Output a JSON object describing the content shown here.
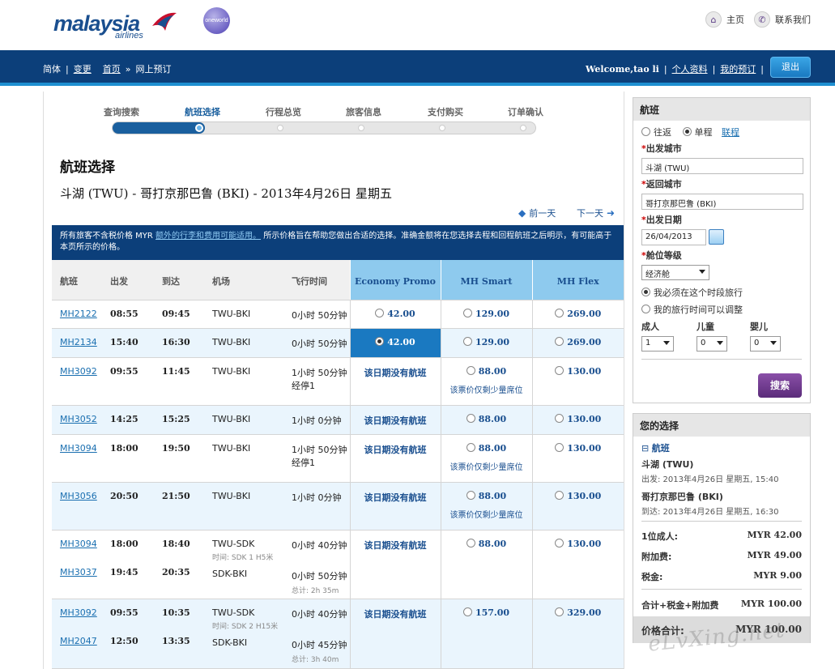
{
  "header": {
    "brand": "malaysia",
    "brand_sub": "airlines",
    "alliance": "oneworld",
    "home": "主页",
    "contact": "联系我们"
  },
  "nav": {
    "lang": "简体",
    "change": "变更",
    "home": "首页",
    "sep": "»",
    "current": "网上预订",
    "welcome": "Welcome,tao li",
    "profile": "个人资料",
    "bookings": "我的预订",
    "logout": "退出"
  },
  "steps": [
    "查询搜索",
    "航班选择",
    "行程总览",
    "旅客信息",
    "支付购买",
    "订单确认"
  ],
  "progress_step": 2,
  "page": {
    "heading": "航班选择",
    "route": "斗湖 (TWU) - 哥打京那巴鲁 (BKI) - 2013年4月26日 星期五",
    "prev_day": "前一天",
    "next_day": "下一天"
  },
  "notice": {
    "part1": "所有旅客不含税价格 MYR ",
    "link": "额外的行李和费用可能适用。",
    "part2": " 所示价格旨在帮助您做出合适的选择。准确金额将在您选择去程和回程航班之后明示，有可能高于本页所示的价格。"
  },
  "table": {
    "headers": [
      "航班",
      "出发",
      "到达",
      "机场",
      "飞行时间"
    ],
    "fares": [
      "Economy Promo",
      "MH Smart",
      "MH Flex"
    ],
    "no_flight": "该日期没有航班",
    "seat_note": "该票价仅剩少量席位",
    "rows": [
      {
        "legs": [
          {
            "flight": "MH2122",
            "dep": "08:55",
            "arr": "09:45",
            "airport": "TWU-BKI",
            "duration": "0小时  50分钟"
          }
        ],
        "promo": "42.00",
        "smart": "129.00",
        "flex": "269.00"
      },
      {
        "legs": [
          {
            "flight": "MH2134",
            "dep": "15:40",
            "arr": "16:30",
            "airport": "TWU-BKI",
            "duration": "0小时  50分钟"
          }
        ],
        "promo": "42.00",
        "smart": "129.00",
        "flex": "269.00",
        "selected": true
      },
      {
        "legs": [
          {
            "flight": "MH3092",
            "dep": "09:55",
            "arr": "11:45",
            "airport": "TWU-BKI",
            "duration": "1小时  50分钟",
            "stop": "经停1"
          }
        ],
        "smart": "88.00",
        "flex": "130.00",
        "seat_note": true
      },
      {
        "legs": [
          {
            "flight": "MH3052",
            "dep": "14:25",
            "arr": "15:25",
            "airport": "TWU-BKI",
            "duration": "1小时  0分钟"
          }
        ],
        "smart": "88.00",
        "flex": "130.00"
      },
      {
        "legs": [
          {
            "flight": "MH3094",
            "dep": "18:00",
            "arr": "19:50",
            "airport": "TWU-BKI",
            "duration": "1小时  50分钟",
            "stop": "经停1"
          }
        ],
        "smart": "88.00",
        "flex": "130.00",
        "seat_note": true
      },
      {
        "legs": [
          {
            "flight": "MH3056",
            "dep": "20:50",
            "arr": "21:50",
            "airport": "TWU-BKI",
            "duration": "1小时  0分钟"
          }
        ],
        "smart": "88.00",
        "flex": "130.00",
        "seat_note": true
      },
      {
        "legs": [
          {
            "flight": "MH3094",
            "dep": "18:00",
            "arr": "18:40",
            "airport": "TWU-SDK",
            "airport_sub": "时间:  SDK 1 H5米",
            "duration": "0小时  40分钟"
          },
          {
            "flight": "MH3037",
            "dep": "19:45",
            "arr": "20:35",
            "airport": "SDK-BKI",
            "duration": "0小时  50分钟",
            "total": "总计:  2h 35m"
          }
        ],
        "smart": "88.00",
        "flex": "130.00"
      },
      {
        "legs": [
          {
            "flight": "MH3092",
            "dep": "09:55",
            "arr": "10:35",
            "airport": "TWU-SDK",
            "airport_sub": "时间:  SDK 2 H15米",
            "duration": "0小时  40分钟"
          },
          {
            "flight": "MH2047",
            "dep": "12:50",
            "arr": "13:35",
            "airport": "SDK-BKI",
            "duration": "0小时  45分钟",
            "total": "总计:  3h 40m"
          }
        ],
        "smart": "157.00",
        "flex": "329.00"
      }
    ]
  },
  "search": {
    "title": "航班",
    "roundtrip": "往返",
    "oneway": "单程",
    "multi": "联程",
    "from_label": "出发城市",
    "from_value": "斗湖  (TWU)",
    "to_label": "返回城市",
    "to_value": "哥打京那巴鲁  (BKI)",
    "date_label": "出发日期",
    "date_value": "26/04/2013",
    "class_label": "舱位等级",
    "class_value": "经济舱",
    "opt_fixed": "我必须在这个时段旅行",
    "opt_flexible": "我的旅行时间可以调整",
    "adult": "成人",
    "child": "儿童",
    "infant": "婴儿",
    "adult_val": "1",
    "child_val": "0",
    "infant_val": "0",
    "button": "搜索"
  },
  "summary": {
    "title": "您的选择",
    "flight_toggle": "航班",
    "from_city": "斗湖  (TWU)",
    "dep_text": "出发:  2013年4月26日  星期五, 15:40",
    "to_city": "哥打京那巴鲁  (BKI)",
    "arr_text": "到达:  2013年4月26日  星期五, 16:30",
    "adult_label": "1位成人:",
    "adult_value": "MYR 42.00",
    "surcharge_label": "附加费:",
    "surcharge_value": "MYR 49.00",
    "tax_label": "税金:",
    "tax_value": "MYR 9.00",
    "subtotal_label": "合计+税金+附加费",
    "subtotal_value": "MYR 100.00",
    "total_label": "价格合计:",
    "total_value": "MYR 100.00"
  },
  "watermark": "eLvXing.net",
  "colors": {
    "navy": "#0c3f7a",
    "accent": "#1e8fd1",
    "fare_header": "#8ecaee",
    "search_button": "#5b2c7a"
  }
}
